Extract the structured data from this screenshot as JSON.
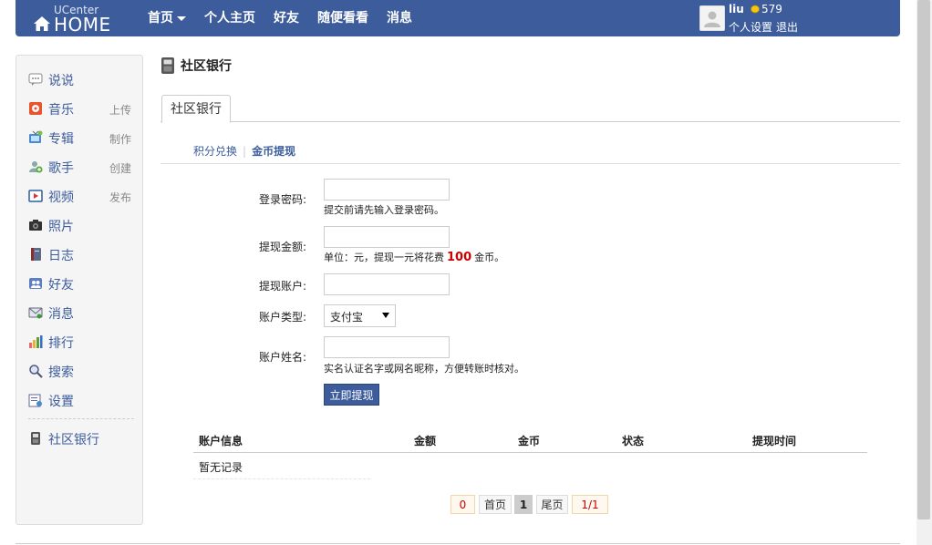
{
  "topbar": {
    "logo_top": "UCenter",
    "logo_main": "HOME",
    "nav": [
      "首页",
      "个人主页",
      "好友",
      "随便看看",
      "消息"
    ],
    "user": {
      "name": "liu",
      "credits": "579",
      "settings": "个人设置",
      "logout": "退出"
    }
  },
  "sidebar": {
    "items": [
      {
        "label": "说说",
        "sub": ""
      },
      {
        "label": "音乐",
        "sub": "上传"
      },
      {
        "label": "专辑",
        "sub": "制作"
      },
      {
        "label": "歌手",
        "sub": "创建"
      },
      {
        "label": "视频",
        "sub": "发布"
      },
      {
        "label": "照片",
        "sub": ""
      },
      {
        "label": "日志",
        "sub": ""
      },
      {
        "label": "好友",
        "sub": ""
      },
      {
        "label": "消息",
        "sub": ""
      },
      {
        "label": "排行",
        "sub": ""
      },
      {
        "label": "搜索",
        "sub": ""
      },
      {
        "label": "设置",
        "sub": ""
      }
    ],
    "bank": "社区银行"
  },
  "page": {
    "title": "社区银行",
    "tab": "社区银行",
    "subtabs": [
      "积分兑换",
      "金币提现"
    ]
  },
  "form": {
    "password_label": "登录密码:",
    "password_hint": "提交前请先输入登录密码。",
    "amount_label": "提现金额:",
    "amount_hint_pre": "单位：元，提现一元将花费",
    "amount_rate": "100",
    "amount_hint_post": "金币。",
    "account_label": "提现账户:",
    "type_label": "账户类型:",
    "type_value": "支付宝",
    "name_label": "账户姓名:",
    "name_hint": "实名认证名字或网名昵称，方便转账时核对。",
    "submit": "立即提现"
  },
  "table": {
    "headers": [
      "账户信息",
      "金额",
      "金币",
      "状态",
      "提现时间"
    ],
    "empty": "暂无记录"
  },
  "pager": {
    "total": "0",
    "first": "首页",
    "current": "1",
    "last": "尾页",
    "pages": "1/1"
  },
  "colors": {
    "brand": "#3c5c9c",
    "highlight": "#cc0000"
  }
}
